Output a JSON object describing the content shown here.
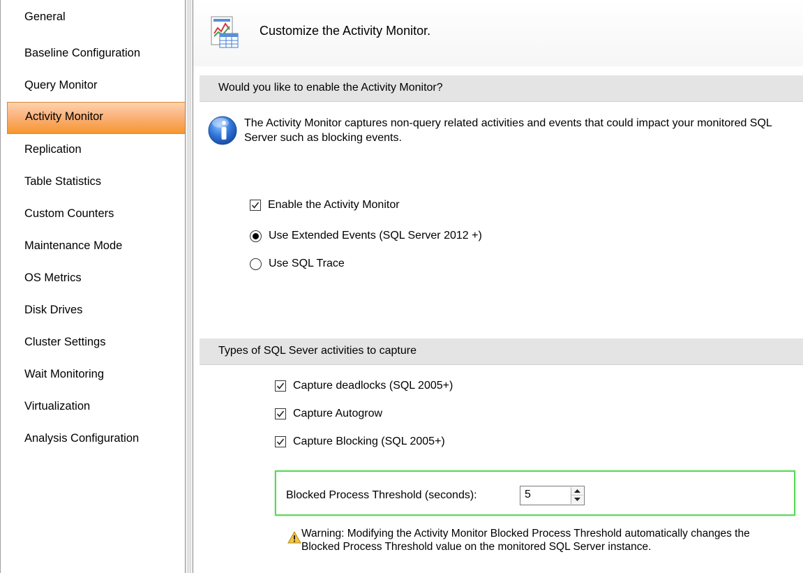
{
  "sidebar": {
    "items": [
      {
        "label": "General",
        "selected": false
      },
      {
        "label": "Baseline Configuration",
        "selected": false
      },
      {
        "label": "Query Monitor",
        "selected": false
      },
      {
        "label": "Activity Monitor",
        "selected": true
      },
      {
        "label": "Replication",
        "selected": false
      },
      {
        "label": "Table Statistics",
        "selected": false
      },
      {
        "label": "Custom Counters",
        "selected": false
      },
      {
        "label": "Maintenance Mode",
        "selected": false
      },
      {
        "label": "OS Metrics",
        "selected": false
      },
      {
        "label": "Disk Drives",
        "selected": false
      },
      {
        "label": "Cluster Settings",
        "selected": false
      },
      {
        "label": "Wait Monitoring",
        "selected": false
      },
      {
        "label": "Virtualization",
        "selected": false
      },
      {
        "label": "Analysis Configuration",
        "selected": false
      }
    ]
  },
  "header": {
    "title": "Customize the Activity Monitor.",
    "icon": "chart-document-icon"
  },
  "enable_section": {
    "title": "Would you like to enable the Activity Monitor?",
    "info_icon": "info-icon",
    "info_text": "The Activity Monitor captures non-query related activities and events that could impact your monitored SQL Server such as blocking events.",
    "enable_checkbox": {
      "label": "Enable the Activity Monitor",
      "checked": true
    },
    "radio_extended_events": {
      "label": "Use Extended Events (SQL Server 2012 +)",
      "selected": true
    },
    "radio_sql_trace": {
      "label": "Use SQL Trace",
      "selected": false
    }
  },
  "types_section": {
    "title": "Types of SQL Sever activities to capture",
    "capture_deadlocks": {
      "label": "Capture deadlocks (SQL 2005+)",
      "checked": true
    },
    "capture_autogrow": {
      "label": "Capture Autogrow",
      "checked": true
    },
    "capture_blocking": {
      "label": "Capture Blocking (SQL 2005+)",
      "checked": true
    },
    "threshold": {
      "label": "Blocked Process Threshold (seconds):",
      "value": "5"
    },
    "warning_icon": "warning-icon",
    "warning_text": "Warning: Modifying the Activity Monitor Blocked Process Threshold automatically changes the Blocked Process Threshold value on the monitored SQL Server instance."
  },
  "colors": {
    "selected_item": "#f6962e",
    "section_band": "#e4e4e4",
    "highlight_border": "#5cd65c"
  }
}
